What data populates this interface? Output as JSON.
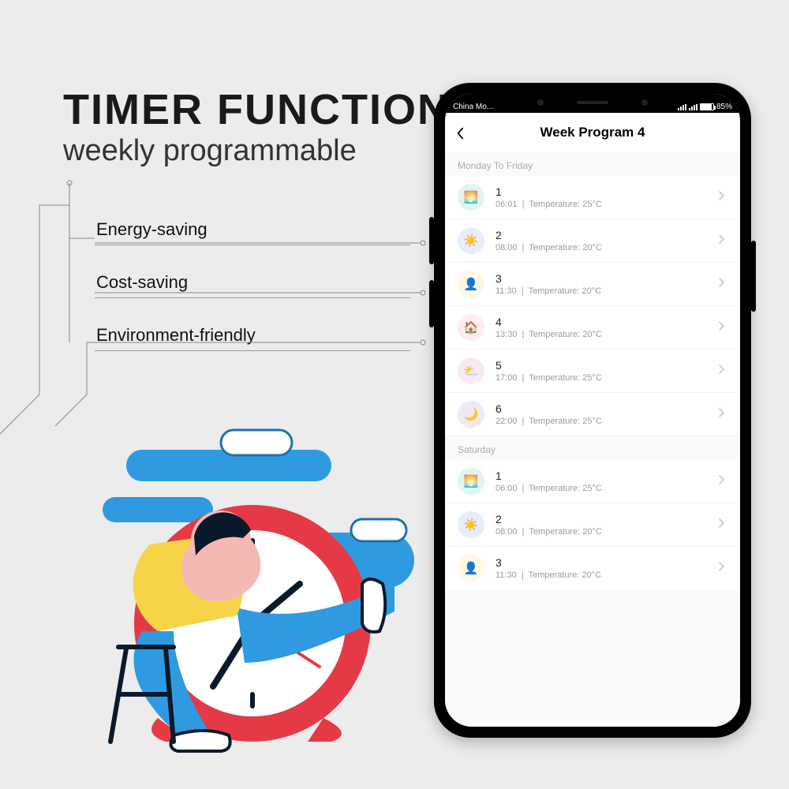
{
  "hero": {
    "title": "TIMER FUNCTION",
    "subtitle": "weekly programmable",
    "bullets": [
      "Energy-saving",
      "Cost-saving",
      "Environment-friendly"
    ]
  },
  "status": {
    "carrier": "China Mo...",
    "battery_pct": "85%"
  },
  "app": {
    "title": "Week Program 4",
    "back_label": "Back",
    "sections": [
      {
        "label": "Monday To Friday",
        "items": [
          {
            "num": "1",
            "time": "06:01",
            "temp": "Temperature: 25°C",
            "icon": "sunrise"
          },
          {
            "num": "2",
            "time": "08:00",
            "temp": "Temperature: 20°C",
            "icon": "sun"
          },
          {
            "num": "3",
            "time": "11:30",
            "temp": "Temperature: 20°C",
            "icon": "person"
          },
          {
            "num": "4",
            "time": "13:30",
            "temp": "Temperature: 20°C",
            "icon": "home"
          },
          {
            "num": "5",
            "time": "17:00",
            "temp": "Temperature: 25°C",
            "icon": "cloud"
          },
          {
            "num": "6",
            "time": "22:00",
            "temp": "Temperature: 25°C",
            "icon": "moon"
          }
        ]
      },
      {
        "label": "Saturday",
        "items": [
          {
            "num": "1",
            "time": "06:00",
            "temp": "Temperature: 25°C",
            "icon": "sunrise"
          },
          {
            "num": "2",
            "time": "08:00",
            "temp": "Temperature: 20°C",
            "icon": "sun"
          },
          {
            "num": "3",
            "time": "11:30",
            "temp": "Temperature: 20°C",
            "icon": "person"
          }
        ]
      }
    ]
  },
  "icon_glyphs": {
    "sunrise": "🌅",
    "sun": "☀️",
    "person": "👤",
    "home": "🏠",
    "cloud": "⛅",
    "moon": "🌙"
  },
  "colors": {
    "accent_red": "#e63946",
    "accent_blue": "#2f9ae0",
    "accent_yellow": "#f5d547"
  }
}
